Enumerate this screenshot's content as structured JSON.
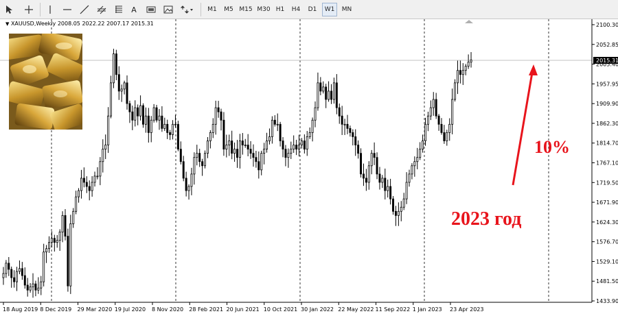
{
  "toolbar": {
    "timeframes": [
      "M1",
      "M5",
      "M15",
      "M30",
      "H1",
      "H4",
      "D1",
      "W1",
      "MN"
    ],
    "selected_timeframe": "W1"
  },
  "chart_header": {
    "symbol": "XAUUSD,Weekly",
    "ohlc": "2008.05 2022.22 2007.17 2015.31"
  },
  "current_price": "2015.31",
  "annotations": {
    "percent": "10%",
    "year": "2023 год",
    "color": "#e8141c"
  },
  "chart_data": {
    "type": "candlestick",
    "title": "XAUUSD,Weekly",
    "x_tick_labels": [
      "18 Aug 2019",
      "8 Dec 2019",
      "29 Mar 2020",
      "19 Jul 2020",
      "8 Nov 2020",
      "28 Feb 2021",
      "20 Jun 2021",
      "10 Oct 2021",
      "30 Jan 2022",
      "22 May 2022",
      "11 Sep 2022",
      "1 Jan 2023",
      "23 Apr 2023"
    ],
    "y_tick_labels": [
      "2100.30",
      "2052.85",
      "2005.40",
      "1957.95",
      "1909.90",
      "1862.30",
      "1814.70",
      "1767.10",
      "1719.50",
      "1671.90",
      "1624.30",
      "1576.70",
      "1529.10",
      "1481.50",
      "1433.90"
    ],
    "ylim": [
      1433.9,
      2100.3
    ],
    "grid": "vertical dashed separators",
    "close_series": [
      1500,
      1525,
      1510,
      1490,
      1480,
      1505,
      1512,
      1495,
      1472,
      1460,
      1468,
      1475,
      1460,
      1465,
      1480,
      1552,
      1560,
      1575,
      1585,
      1575,
      1580,
      1600,
      1640,
      1590,
      1470,
      1620,
      1650,
      1685,
      1700,
      1730,
      1720,
      1710,
      1700,
      1720,
      1735,
      1735,
      1770,
      1800,
      1810,
      1880,
      1960,
      2030,
      1980,
      1940,
      1945,
      1960,
      1910,
      1890,
      1870,
      1900,
      1880,
      1905,
      1860,
      1880,
      1840,
      1870,
      1900,
      1870,
      1880,
      1850,
      1860,
      1840,
      1835,
      1860,
      1860,
      1800,
      1770,
      1730,
      1700,
      1710,
      1740,
      1780,
      1790,
      1770,
      1760,
      1790,
      1820,
      1840,
      1860,
      1900,
      1890,
      1870,
      1800,
      1810,
      1820,
      1790,
      1800,
      1780,
      1820,
      1810,
      1810,
      1800,
      1790,
      1780,
      1770,
      1750,
      1790,
      1800,
      1820,
      1830,
      1870,
      1860,
      1860,
      1820,
      1800,
      1780,
      1790,
      1800,
      1810,
      1800,
      1810,
      1820,
      1800,
      1830,
      1840,
      1870,
      1900,
      1960,
      1940,
      1950,
      1920,
      1940,
      1920,
      1960,
      1900,
      1880,
      1860,
      1860,
      1850,
      1840,
      1830,
      1810,
      1790,
      1740,
      1730,
      1720,
      1760,
      1790,
      1780,
      1740,
      1720,
      1730,
      1700,
      1710,
      1680,
      1650,
      1640,
      1650,
      1660,
      1680,
      1720,
      1740,
      1760,
      1770,
      1780,
      1800,
      1820,
      1860,
      1880,
      1900,
      1920,
      1880,
      1860,
      1840,
      1820,
      1840,
      1860,
      1920,
      1960,
      1990,
      1980,
      1990,
      2000,
      2010,
      2015.31
    ]
  }
}
